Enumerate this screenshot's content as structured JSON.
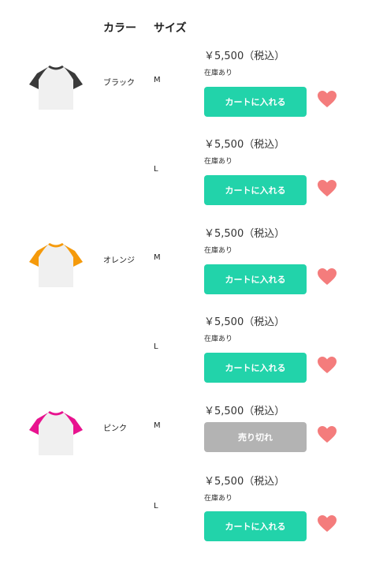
{
  "header": {
    "color": "カラー",
    "size": "サイズ"
  },
  "variants": [
    {
      "shirt_color": "#3a3a3a",
      "color": "ブラック",
      "size": "M",
      "price": "￥5,500（税込）",
      "stock": "在庫あり",
      "button": "カートに入れる",
      "status": "available"
    },
    {
      "shirt_color": "",
      "color": "",
      "size": "L",
      "price": "￥5,500（税込）",
      "stock": "在庫あり",
      "button": "カートに入れる",
      "status": "available"
    },
    {
      "shirt_color": "#f59a0b",
      "color": "オレンジ",
      "size": "M",
      "price": "￥5,500（税込）",
      "stock": "在庫あり",
      "button": "カートに入れる",
      "status": "available"
    },
    {
      "shirt_color": "",
      "color": "",
      "size": "L",
      "price": "￥5,500（税込）",
      "stock": "在庫あり",
      "button": "カートに入れる",
      "status": "available"
    },
    {
      "shirt_color": "#e8138f",
      "color": "ピンク",
      "size": "M",
      "price": "￥5,500（税込）",
      "stock": "",
      "button": "売り切れ",
      "status": "sold-out"
    },
    {
      "shirt_color": "",
      "color": "",
      "size": "L",
      "price": "￥5,500（税込）",
      "stock": "在庫あり",
      "button": "カートに入れる",
      "status": "available"
    }
  ],
  "colors": {
    "cart_button": "#22d3aa",
    "sold_out_button": "#b3b3b3",
    "heart": "#f47c7c"
  },
  "icons": {
    "favorite": "heart-icon"
  }
}
